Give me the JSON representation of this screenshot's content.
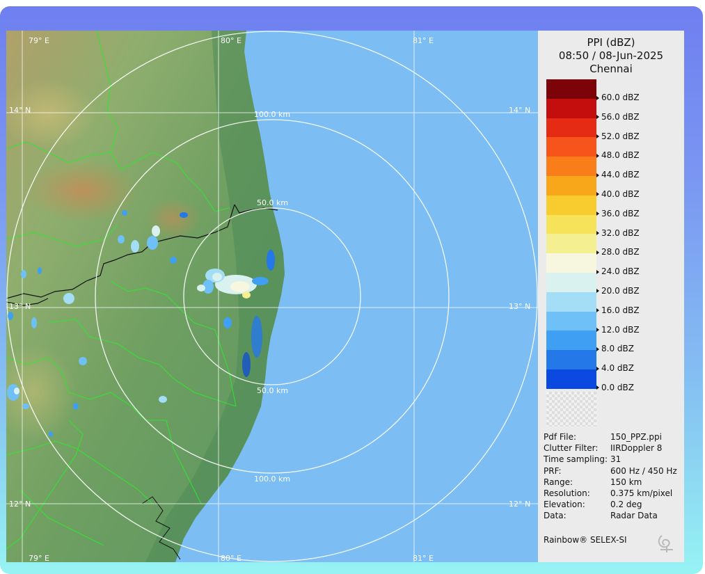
{
  "legend": {
    "title": "PPI (dBZ)",
    "datetime": "08:50 / 08-Jun-2025",
    "station": "Chennai",
    "scale": [
      {
        "label": "60.0 dBZ",
        "color": "#7c0408"
      },
      {
        "label": "56.0 dBZ",
        "color": "#c40d0d"
      },
      {
        "label": "52.0 dBZ",
        "color": "#e52b14"
      },
      {
        "label": "48.0 dBZ",
        "color": "#f6541a"
      },
      {
        "label": "44.0 dBZ",
        "color": "#f97e1a"
      },
      {
        "label": "40.0 dBZ",
        "color": "#f9a71a"
      },
      {
        "label": "36.0 dBZ",
        "color": "#f8cb2e"
      },
      {
        "label": "32.0 dBZ",
        "color": "#f7e35a"
      },
      {
        "label": "28.0 dBZ",
        "color": "#f4f092"
      },
      {
        "label": "24.0 dBZ",
        "color": "#f7f6df"
      },
      {
        "label": "20.0 dBZ",
        "color": "#d9f1ef"
      },
      {
        "label": "16.0 dBZ",
        "color": "#a3ddf6"
      },
      {
        "label": "12.0 dBZ",
        "color": "#6ec0f6"
      },
      {
        "label": "8.0 dBZ",
        "color": "#3f9ff2"
      },
      {
        "label": "4.0 dBZ",
        "color": "#2478e8"
      },
      {
        "label": "0.0 dBZ",
        "color": "#0b49e0"
      }
    ]
  },
  "metadata": [
    {
      "key": "Pdf File:",
      "value": "150_PPZ.ppi"
    },
    {
      "key": "Clutter Filter:",
      "value": "IIRDoppler 8"
    },
    {
      "key": "Time sampling:",
      "value": "31"
    },
    {
      "key": "PRF:",
      "value": "600 Hz / 450 Hz"
    },
    {
      "key": "Range:",
      "value": "150 km"
    },
    {
      "key": "Resolution:",
      "value": "0.375 km/pixel"
    },
    {
      "key": "Elevation:",
      "value": "0.2 deg"
    },
    {
      "key": "Data:",
      "value": "Radar Data"
    }
  ],
  "brand": "Rainbow® SELEX-SI",
  "map": {
    "lon_labels_top": [
      "79° E",
      "80° E",
      "81° E"
    ],
    "lon_labels_bottom": [
      "79° E",
      "80° E",
      "81° E"
    ],
    "lat_labels_left": [
      "14° N",
      "13° N",
      "12° N"
    ],
    "lat_labels_right": [
      "14° N",
      "13° N",
      "12° N"
    ],
    "ring_labels": [
      "100.0 km",
      "50.0 km",
      "50.0 km",
      "100.0 km"
    ],
    "ocean_color": "#7cbdf3",
    "land_color": "#5d9a62"
  }
}
